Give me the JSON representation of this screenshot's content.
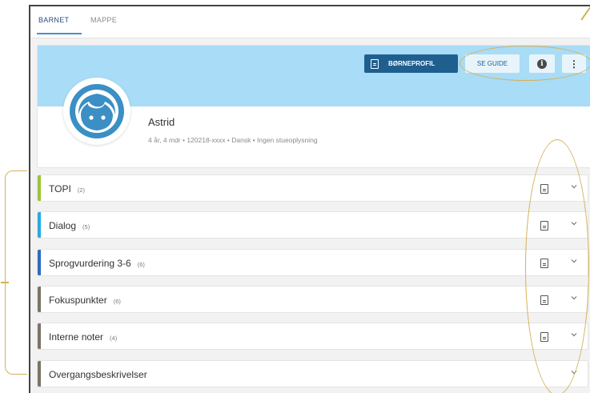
{
  "tabs": [
    {
      "label": "BARNET",
      "active": true
    },
    {
      "label": "MAPPE",
      "active": false
    }
  ],
  "header": {
    "profile_button": "BØRNEPROFIL",
    "guide_button": "SE GUIDE",
    "info_icon": "info-icon",
    "more_icon": "more-vertical-icon",
    "more_glyph": "⋮",
    "info_glyph": "i"
  },
  "child": {
    "name": "Astrid",
    "meta": "4 år, 4 mdr • 120218-xxxx • Dansk • Ingen stueoplysning"
  },
  "sections": [
    {
      "label": "TOPI",
      "count": "(2)",
      "color": "#9bc43b",
      "has_doc": true
    },
    {
      "label": "Dialog",
      "count": "(5)",
      "color": "#29a9e1",
      "has_doc": true
    },
    {
      "label": "Sprogvurdering 3-6",
      "count": "(6)",
      "color": "#2d6cc0",
      "has_doc": true
    },
    {
      "label": "Fokuspunkter",
      "count": "(6)",
      "color": "#7a7568",
      "has_doc": true
    },
    {
      "label": "Interne noter",
      "count": "(4)",
      "color": "#7a7568",
      "has_doc": true
    },
    {
      "label": "Overgangsbeskrivelser",
      "count": "",
      "color": "#7a7568",
      "has_doc": false
    }
  ],
  "colors": {
    "banner": "#a9dcf6",
    "primary": "#1f5f8f",
    "annotation": "#d4b15a"
  }
}
